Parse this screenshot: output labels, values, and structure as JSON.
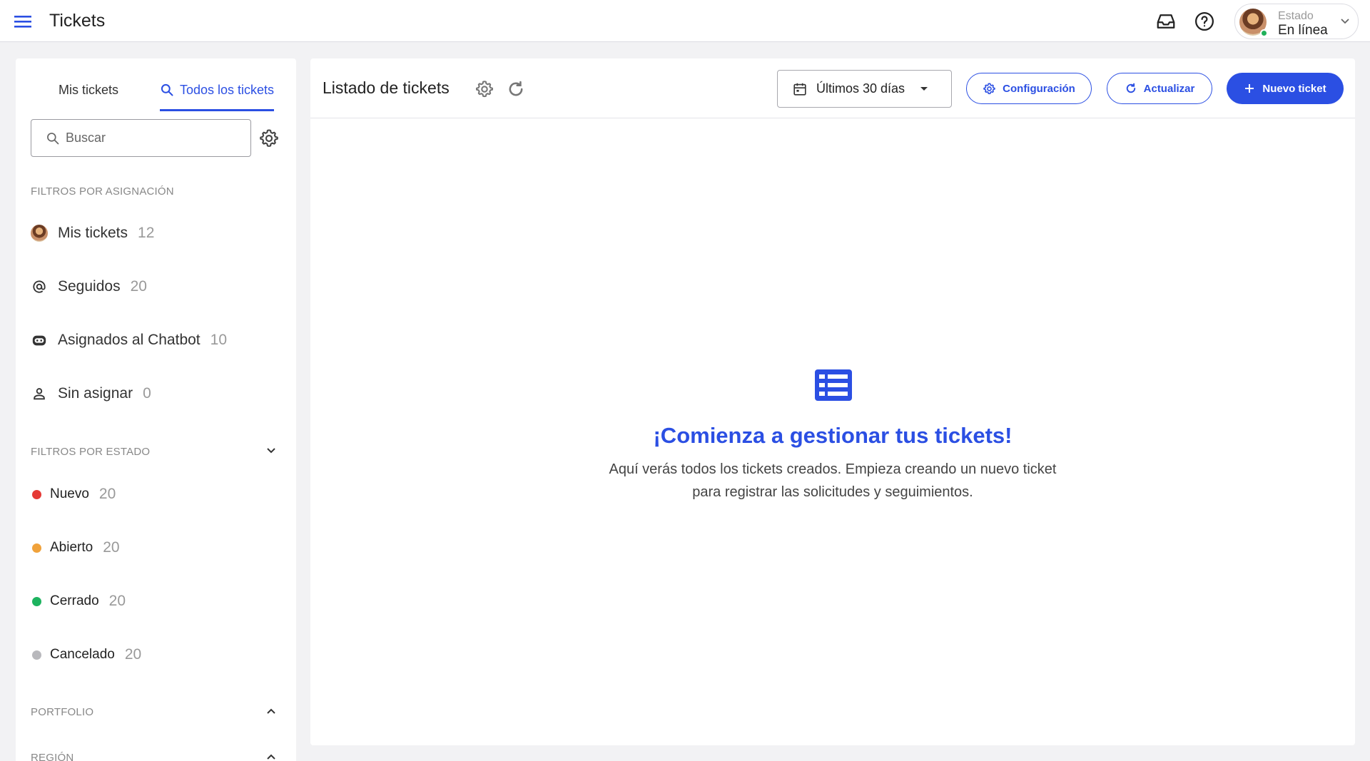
{
  "app": {
    "title": "Tickets"
  },
  "user": {
    "status_label": "Estado",
    "status_value": "En línea"
  },
  "tabs": {
    "mis": "Mis tickets",
    "todos": "Todos los tickets"
  },
  "search": {
    "placeholder": "Buscar"
  },
  "assign_filters": {
    "heading": "FILTROS POR ASIGNACIÓN",
    "items": [
      {
        "label": "Mis tickets",
        "count": "12",
        "icon": "avatar"
      },
      {
        "label": "Seguidos",
        "count": "20",
        "icon": "at-icon"
      },
      {
        "label": "Asignados al Chatbot",
        "count": "10",
        "icon": "bot-icon"
      },
      {
        "label": "Sin asignar",
        "count": "0",
        "icon": "person-icon"
      }
    ]
  },
  "status_filters": {
    "heading": "FILTROS POR ESTADO",
    "items": [
      {
        "label": "Nuevo",
        "count": "20",
        "color": "#e53935"
      },
      {
        "label": "Abierto",
        "count": "20",
        "color": "#f0a23b"
      },
      {
        "label": "Cerrado",
        "count": "20",
        "color": "#1db35f"
      },
      {
        "label": "Cancelado",
        "count": "20",
        "color": "#b8b8bc"
      }
    ]
  },
  "portfolio": {
    "heading": "PORTFOLIO"
  },
  "region": {
    "heading": "REGIÓN"
  },
  "main": {
    "title": "Listado de tickets",
    "date_range": "Últimos 30 días",
    "config_label": "Configuración",
    "refresh_label": "Actualizar",
    "new_label": "Nuevo ticket",
    "empty_title": "¡Comienza a gestionar tus tickets!",
    "empty_line1": "Aquí verás todos los tickets creados. Empieza creando un nuevo ticket",
    "empty_line2": "para registrar las solicitudes y seguimientos."
  },
  "colors": {
    "accent": "#2b4fe3",
    "online": "#20b15a"
  }
}
